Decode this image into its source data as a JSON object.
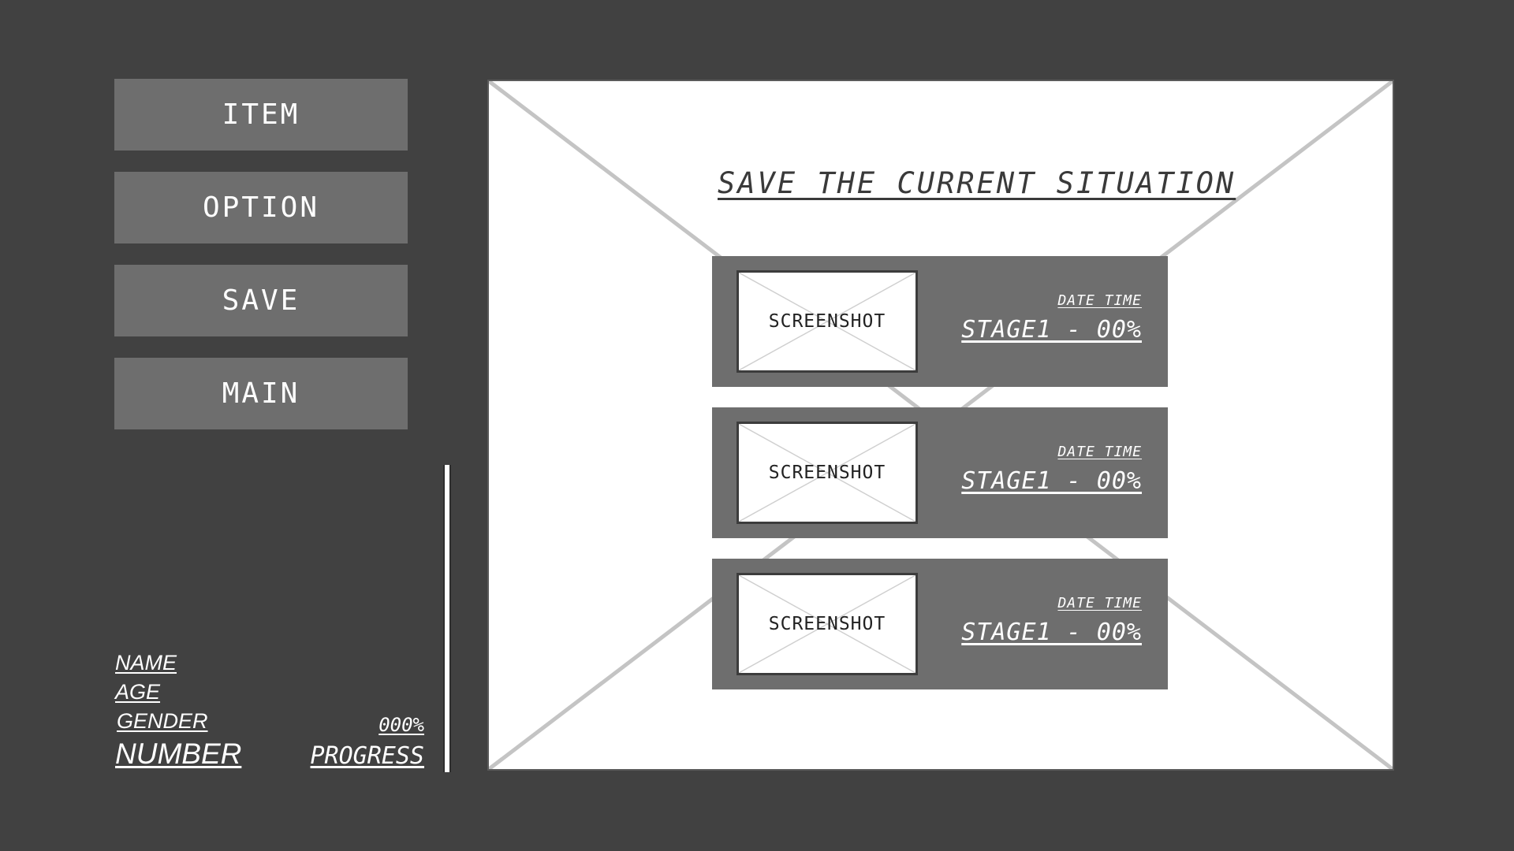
{
  "menu": {
    "item_label": "ITEM",
    "option_label": "OPTION",
    "save_label": "SAVE",
    "main_label": "MAIN"
  },
  "player": {
    "name_label": "NAME",
    "age_label": "AGE",
    "gender_label": "GENDER",
    "number_label": "NUMBER",
    "progress_value": "000%",
    "progress_label": "PROGRESS"
  },
  "save_panel": {
    "title": "SAVE THE CURRENT SITUATION",
    "slots": [
      {
        "thumbnail": "SCREENSHOT",
        "datetime": "DATE TIME",
        "stage": "STAGE1 - 00%"
      },
      {
        "thumbnail": "SCREENSHOT",
        "datetime": "DATE TIME",
        "stage": "STAGE1 - 00%"
      },
      {
        "thumbnail": "SCREENSHOT",
        "datetime": "DATE TIME",
        "stage": "STAGE1 - 00%"
      }
    ]
  },
  "colors": {
    "background": "#414141",
    "button": "#6e6e6e",
    "panel": "#ffffff",
    "text": "#ffffff"
  }
}
